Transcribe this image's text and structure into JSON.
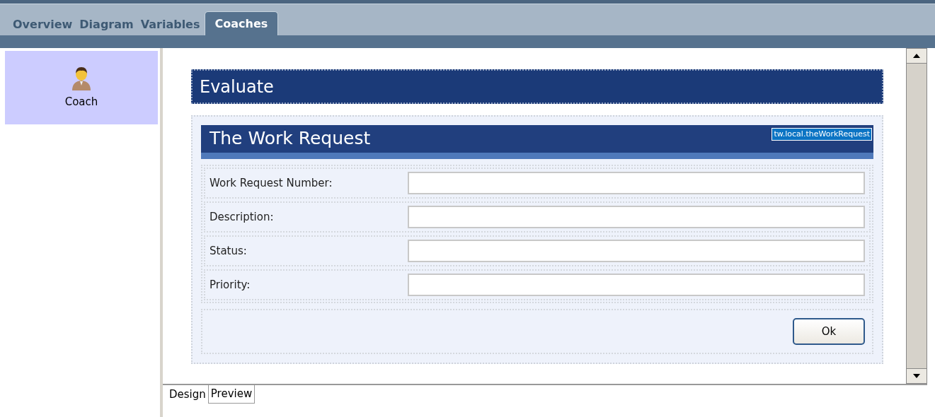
{
  "tabs": [
    {
      "label": "Overview",
      "selected": false
    },
    {
      "label": "Diagram",
      "selected": false
    },
    {
      "label": "Variables",
      "selected": false
    },
    {
      "label": "Coaches",
      "selected": true
    }
  ],
  "sidebar": {
    "items": [
      {
        "label": "Coach",
        "selected": true
      }
    ]
  },
  "coach": {
    "title": "Evaluate",
    "section": {
      "title": "The Work Request",
      "binding": "tw.local.theWorkRequest",
      "fields": [
        {
          "label": "Work Request Number:"
        },
        {
          "label": "Description:"
        },
        {
          "label": "Status:"
        },
        {
          "label": "Priority:"
        }
      ]
    },
    "buttons": [
      "Ok"
    ]
  },
  "bottom_tabs": [
    {
      "label": "Design",
      "selected": true
    },
    {
      "label": "Preview",
      "selected": false
    }
  ]
}
